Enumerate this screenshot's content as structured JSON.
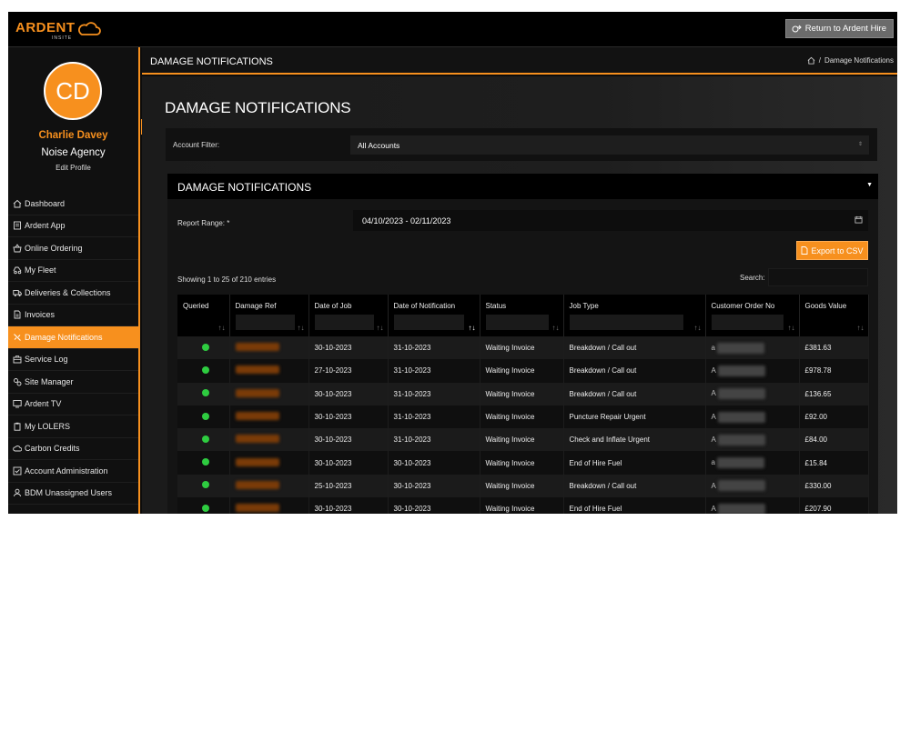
{
  "topbar": {
    "logo_text": "ARDENT",
    "logo_sub": "INSITE",
    "return_label": "Return to Ardent Hire"
  },
  "sidebar": {
    "avatar_initials": "CD",
    "user_name": "Charlie Davey",
    "company": "Noise Agency",
    "edit_profile": "Edit Profile",
    "items": [
      {
        "label": "Dashboard",
        "icon": "home-icon"
      },
      {
        "label": "Ardent App",
        "icon": "app-icon"
      },
      {
        "label": "Online Ordering",
        "icon": "basket-icon"
      },
      {
        "label": "My Fleet",
        "icon": "fleet-icon"
      },
      {
        "label": "Deliveries & Collections",
        "icon": "truck-icon"
      },
      {
        "label": "Invoices",
        "icon": "document-icon"
      },
      {
        "label": "Damage Notifications",
        "icon": "wrench-icon",
        "active": true
      },
      {
        "label": "Service Log",
        "icon": "service-icon"
      },
      {
        "label": "Site Manager",
        "icon": "gears-icon"
      },
      {
        "label": "Ardent TV",
        "icon": "tv-icon"
      },
      {
        "label": "My LOLERS",
        "icon": "clipboard-icon"
      },
      {
        "label": "Carbon Credits",
        "icon": "cloud-icon"
      },
      {
        "label": "Account Administration",
        "icon": "check-square-icon"
      },
      {
        "label": "BDM Unassigned Users",
        "icon": "user-icon"
      }
    ]
  },
  "header": {
    "title": "DAMAGE NOTIFICATIONS",
    "breadcrumb_current": "Damage Notifications"
  },
  "main": {
    "title": "DAMAGE NOTIFICATIONS",
    "account_filter_label": "Account Filter:",
    "account_filter_value": "All Accounts",
    "panel_title": "DAMAGE NOTIFICATIONS",
    "report_range_label": "Report Range: *",
    "report_range_value": "04/10/2023 - 02/11/2023",
    "export_label": "Export to CSV",
    "showing_text": "Showing 1 to 25 of 210 entries",
    "search_label": "Search:"
  },
  "table": {
    "columns": [
      "Queried",
      "Damage Ref",
      "Date of Job",
      "Date of Notification",
      "Status",
      "Job Type",
      "Customer Order No",
      "Goods Value"
    ],
    "rows": [
      {
        "date_job": "30-10-2023",
        "date_notif": "31-10-2023",
        "status": "Waiting Invoice",
        "job_type": "Breakdown / Call out",
        "order_prefix": "a",
        "value": "£381.63"
      },
      {
        "date_job": "27-10-2023",
        "date_notif": "31-10-2023",
        "status": "Waiting Invoice",
        "job_type": "Breakdown / Call out",
        "order_prefix": "A",
        "value": "£978.78"
      },
      {
        "date_job": "30-10-2023",
        "date_notif": "31-10-2023",
        "status": "Waiting Invoice",
        "job_type": "Breakdown / Call out",
        "order_prefix": "A",
        "value": "£136.65"
      },
      {
        "date_job": "30-10-2023",
        "date_notif": "31-10-2023",
        "status": "Waiting Invoice",
        "job_type": "Puncture Repair Urgent",
        "order_prefix": "A",
        "value": "£92.00"
      },
      {
        "date_job": "30-10-2023",
        "date_notif": "31-10-2023",
        "status": "Waiting Invoice",
        "job_type": "Check and Inflate Urgent",
        "order_prefix": "A",
        "value": "£84.00"
      },
      {
        "date_job": "30-10-2023",
        "date_notif": "30-10-2023",
        "status": "Waiting Invoice",
        "job_type": "End of Hire Fuel",
        "order_prefix": "a",
        "value": "£15.84"
      },
      {
        "date_job": "25-10-2023",
        "date_notif": "30-10-2023",
        "status": "Waiting Invoice",
        "job_type": "Breakdown / Call out",
        "order_prefix": "A",
        "value": "£330.00"
      },
      {
        "date_job": "30-10-2023",
        "date_notif": "30-10-2023",
        "status": "Waiting Invoice",
        "job_type": "End of Hire Fuel",
        "order_prefix": "A",
        "value": "£207.90"
      }
    ]
  },
  "colors": {
    "accent": "#f7901e",
    "queried_dot": "#2ecc40"
  }
}
